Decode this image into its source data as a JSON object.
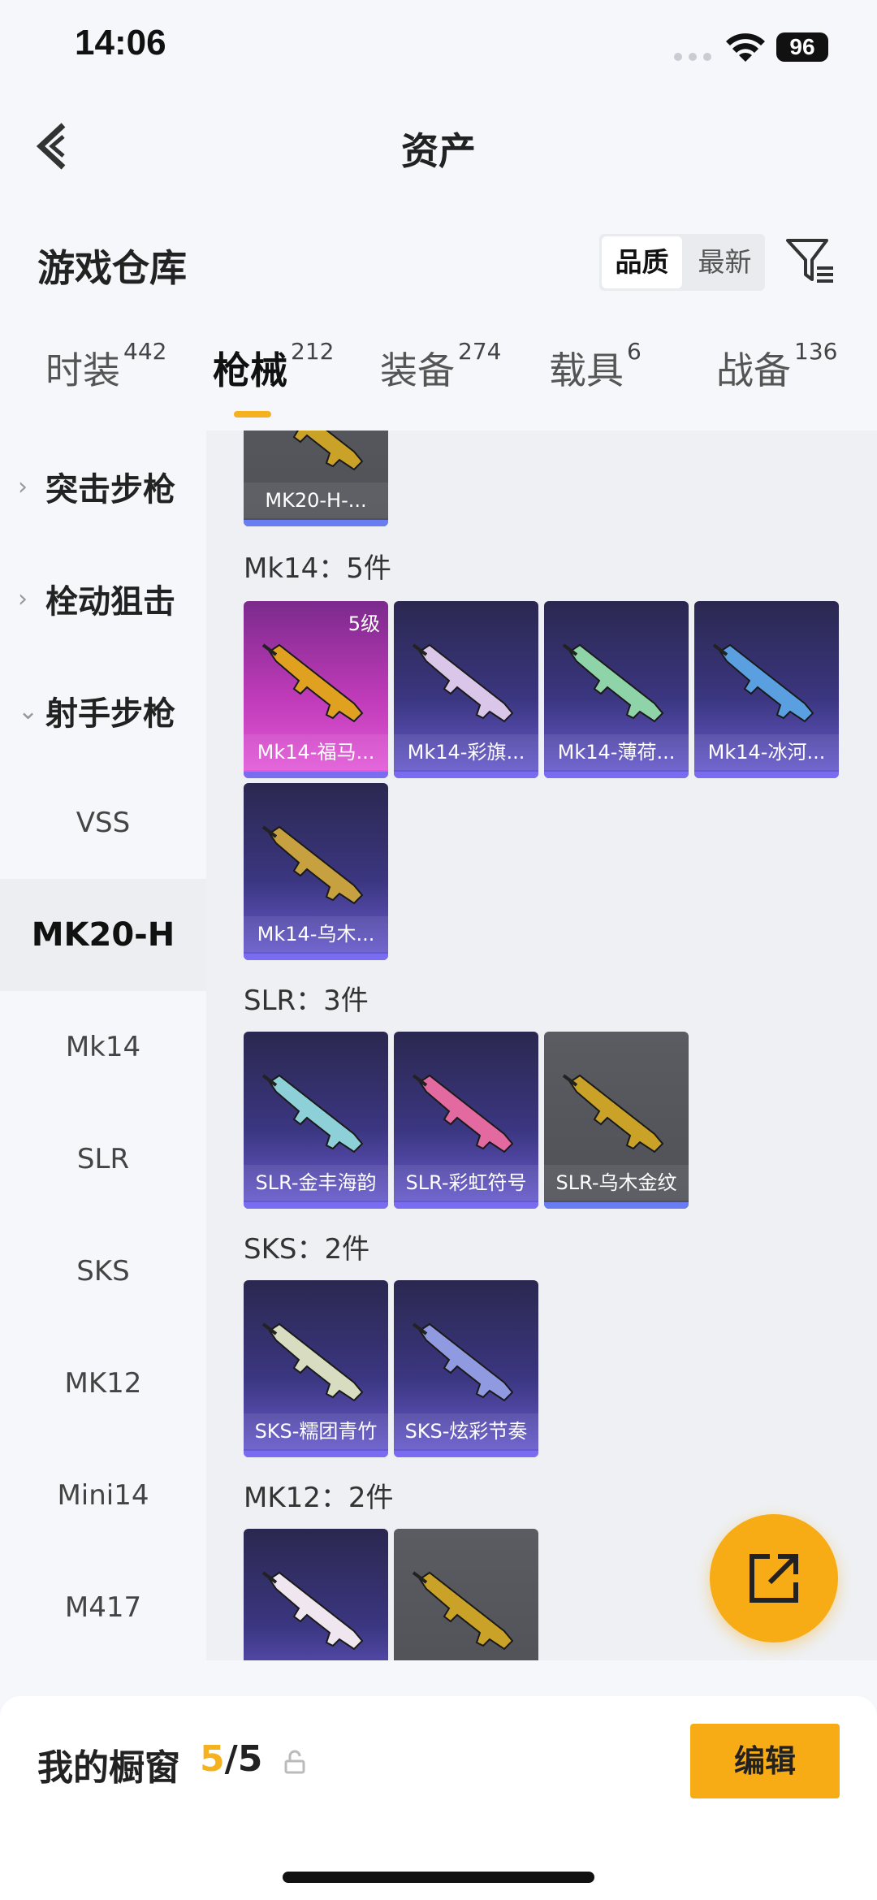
{
  "status": {
    "time": "14:06",
    "battery": "96"
  },
  "header": {
    "title": "资产"
  },
  "warehouse": {
    "title": "游戏仓库",
    "sort_options": [
      "品质",
      "最新"
    ]
  },
  "tabs": [
    {
      "label": "时装",
      "count": "442"
    },
    {
      "label": "枪械",
      "count": "212"
    },
    {
      "label": "装备",
      "count": "274"
    },
    {
      "label": "载具",
      "count": "6"
    },
    {
      "label": "战备",
      "count": "136"
    }
  ],
  "sidebar": {
    "categories": [
      {
        "label": "突击步枪",
        "chevron": "›"
      },
      {
        "label": "栓动狙击",
        "chevron": "›"
      },
      {
        "label": "射手步枪",
        "chevron": "⌄"
      }
    ],
    "items": [
      "VSS",
      "MK20-H",
      "Mk14",
      "SLR",
      "SKS",
      "MK12",
      "Mini14",
      "M417"
    ],
    "selected": "MK20-H"
  },
  "groups": [
    {
      "label": "",
      "cards": [
        {
          "name": "MK20-H-...",
          "rarity": "gray",
          "color": "#c9a227"
        }
      ]
    },
    {
      "label": "Mk14：5件",
      "cards": [
        {
          "name": "Mk14-福马...",
          "rarity": "pink",
          "level": "5级",
          "color": "#e0a020"
        },
        {
          "name": "Mk14-彩旗...",
          "rarity": "purple",
          "color": "#d9c6e8"
        },
        {
          "name": "Mk14-薄荷...",
          "rarity": "purple",
          "color": "#8fd4a8"
        },
        {
          "name": "Mk14-冰河...",
          "rarity": "purple",
          "color": "#5aa0e0"
        },
        {
          "name": "Mk14-乌木...",
          "rarity": "purple",
          "color": "#c7a040"
        }
      ]
    },
    {
      "label": "SLR：3件",
      "cards": [
        {
          "name": "SLR-金丰海韵",
          "rarity": "purple",
          "color": "#8ed0d8"
        },
        {
          "name": "SLR-彩虹符号",
          "rarity": "purple",
          "color": "#e26aa0"
        },
        {
          "name": "SLR-乌木金纹",
          "rarity": "gray",
          "color": "#c9a227"
        }
      ]
    },
    {
      "label": "SKS：2件",
      "cards": [
        {
          "name": "SKS-糯团青竹",
          "rarity": "purple",
          "color": "#d8dcc0"
        },
        {
          "name": "SKS-炫彩节奏",
          "rarity": "purple",
          "color": "#8f9ae0"
        }
      ]
    },
    {
      "label": "MK12：2件",
      "cards": [
        {
          "name": "",
          "rarity": "purple",
          "color": "#f0e6f0"
        },
        {
          "name": "",
          "rarity": "gray",
          "color": "#c9a227"
        }
      ]
    }
  ],
  "bottom": {
    "label": "我的橱窗",
    "current": "5",
    "total": "/5",
    "edit": "编辑"
  },
  "colors": {
    "accent": "#f7ab14",
    "purple_card": "#3b3680",
    "pink_card": "#c03bb9",
    "gray_card": "#5a5c62"
  },
  "icons": {
    "back": "chevron-left-icon",
    "filter": "filter-icon",
    "share": "share-external-icon",
    "lock": "unlock-icon"
  }
}
